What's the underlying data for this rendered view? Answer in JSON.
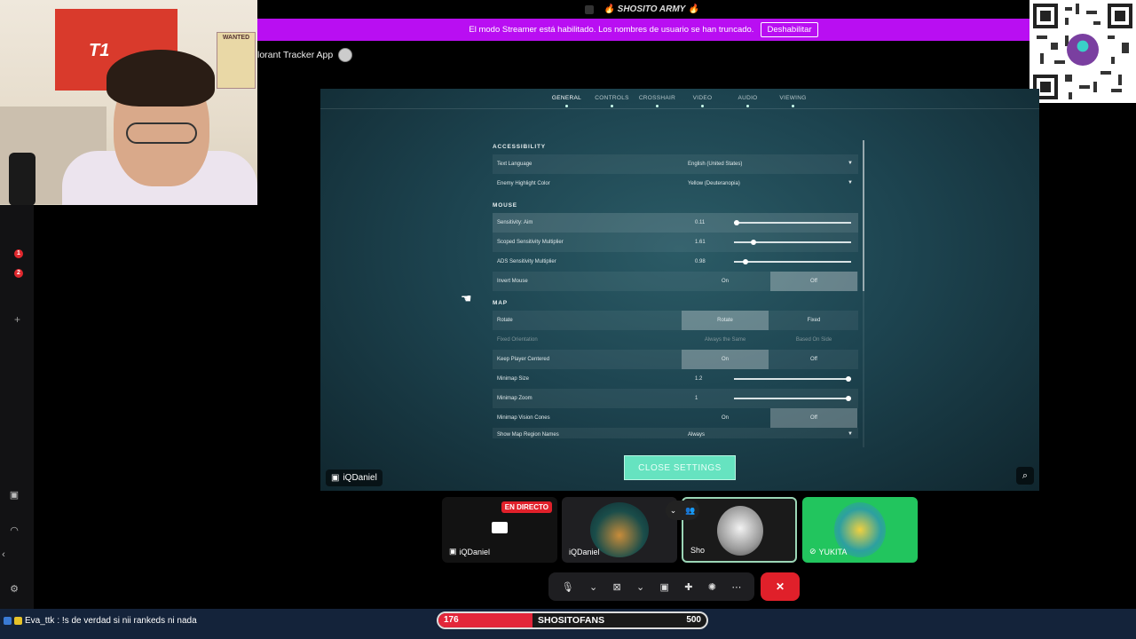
{
  "titlebar": {
    "label": "SHOSITO ARMY",
    "flame": "🔥"
  },
  "banner": {
    "message": "El modo Streamer está habilitado. Los nombres de usuario se han truncado.",
    "disable_label": "Deshabilitar"
  },
  "webcam": {
    "flag_text": "T1",
    "poster_text": "WANTED"
  },
  "call": {
    "title": "lorant Tracker App"
  },
  "game": {
    "tabs": [
      "GENERAL",
      "CONTROLS",
      "CROSSHAIR",
      "VIDEO",
      "AUDIO",
      "VIEWING"
    ],
    "active_tab": "GENERAL",
    "sections": {
      "accessibility": "ACCESSIBILITY",
      "mouse": "MOUSE",
      "map": "MAP"
    },
    "rows": {
      "text_language": {
        "label": "Text Language",
        "value": "English (United States)"
      },
      "enemy_highlight": {
        "label": "Enemy Highlight Color",
        "value": "Yellow (Deuteranopia)"
      },
      "sens_aim": {
        "label": "Sensitivity: Aim",
        "value": "0.11",
        "level": 0.0
      },
      "scoped_sens": {
        "label": "Scoped Sensitivity Multiplier",
        "value": "1.61",
        "level": 0.15
      },
      "ads_sens": {
        "label": "ADS Sensitivity Multiplier",
        "value": "0.98",
        "level": 0.08
      },
      "invert_mouse": {
        "label": "Invert Mouse",
        "on": "On",
        "off": "Off",
        "selected": "Off"
      },
      "rotate": {
        "label": "Rotate",
        "on": "Rotate",
        "off": "Fixed",
        "selected": "Rotate"
      },
      "fixed_orientation": {
        "label": "Fixed Orientation",
        "on": "Always the Same",
        "off": "Based On Side"
      },
      "keep_centered": {
        "label": "Keep Player Centered",
        "on": "On",
        "off": "Off",
        "selected": "On"
      },
      "minimap_size": {
        "label": "Minimap Size",
        "value": "1.2",
        "level": 1.0
      },
      "minimap_zoom": {
        "label": "Minimap Zoom",
        "value": "1",
        "level": 1.0
      },
      "vision_cones": {
        "label": "Minimap Vision Cones",
        "on": "On",
        "off": "Off",
        "selected": "Off"
      },
      "region_names": {
        "label": "Show Map Region Names",
        "value": "Always"
      }
    },
    "close_label": "CLOSE SETTINGS",
    "presenter": "iQDaniel"
  },
  "tiles": [
    {
      "name": "iQDaniel",
      "badge": "EN DIRECTO"
    },
    {
      "name": "iQDaniel"
    },
    {
      "name": "Sho"
    },
    {
      "name": "YUKITA"
    }
  ],
  "bottom": {
    "chat_user": "Eva_ttk",
    "chat_text": ": !s de verdad si nii rankeds ni nada",
    "goal_title": "SHOSITOFANS",
    "goal_current": "176",
    "goal_max": "500",
    "goal_progress": 0.352
  },
  "colors": {
    "banner": "#b90ef2",
    "live": "#e0202a",
    "goal_fill": "#e3263a",
    "close_btn": "#66e3c0",
    "tile_green": "#22c55e"
  }
}
